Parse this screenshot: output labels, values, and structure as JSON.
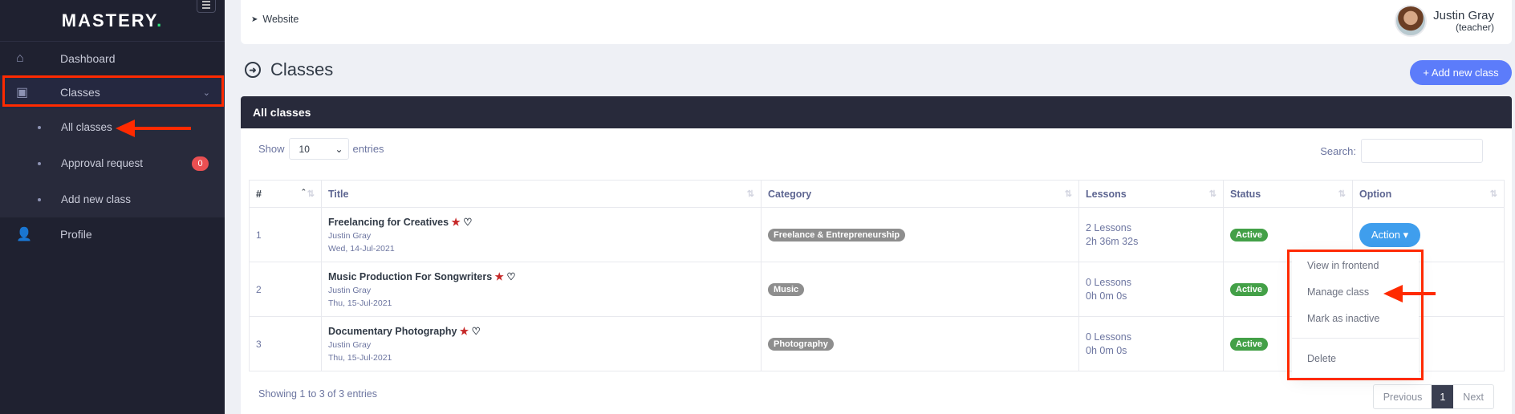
{
  "sidebar": {
    "brand": "MASTERY",
    "brand_dot": ".",
    "items": [
      {
        "label": "Dashboard",
        "icon": "home-icon"
      },
      {
        "label": "Classes",
        "icon": "chalkboard-teacher-icon",
        "expanded": true
      },
      {
        "label": "Profile",
        "icon": "user-icon"
      }
    ],
    "submenu": [
      {
        "label": "All classes"
      },
      {
        "label": "Approval request",
        "badge": "0"
      },
      {
        "label": "Add new class"
      }
    ]
  },
  "topbar": {
    "website_label": "Website",
    "user_name": "Justin Gray",
    "user_role": "(teacher)"
  },
  "page": {
    "title": "Classes",
    "add_button": "+ Add new class"
  },
  "card": {
    "title": "All classes",
    "show_label": "Show",
    "entries_label": "entries",
    "page_size": "10",
    "search_label": "Search:",
    "search_value": "",
    "columns": [
      "#",
      "Title",
      "Category",
      "Lessons",
      "Status",
      "Option"
    ],
    "rows": [
      {
        "num": "1",
        "title": "Freelancing for Creatives",
        "author": "Justin Gray",
        "date": "Wed, 14-Jul-2021",
        "category": "Freelance & Entrepreneurship",
        "lessons": "2 Lessons",
        "duration": "2h 36m 32s",
        "status": "Active",
        "action": "Action"
      },
      {
        "num": "2",
        "title": "Music Production For Songwriters",
        "author": "Justin Gray",
        "date": "Thu, 15-Jul-2021",
        "category": "Music",
        "lessons": "0 Lessons",
        "duration": "0h 0m 0s",
        "status": "Active"
      },
      {
        "num": "3",
        "title": "Documentary Photography",
        "author": "Justin Gray",
        "date": "Thu, 15-Jul-2021",
        "category": "Photography",
        "lessons": "0 Lessons",
        "duration": "0h 0m 0s",
        "status": "Active"
      }
    ],
    "footer_info": "Showing 1 to 3 of 3 entries",
    "pager": {
      "previous": "Previous",
      "current": "1",
      "next": "Next"
    }
  },
  "dropdown": {
    "items": [
      "View in frontend",
      "Manage class",
      "Mark as inactive"
    ],
    "danger_item": "Delete"
  },
  "colors": {
    "sidebar_bg": "#1f2130",
    "card_header_bg": "#282a3b",
    "primary": "#5c7cfa",
    "action": "#3f9eed",
    "active_badge": "#43a047",
    "annotation": "#ff2a00"
  }
}
